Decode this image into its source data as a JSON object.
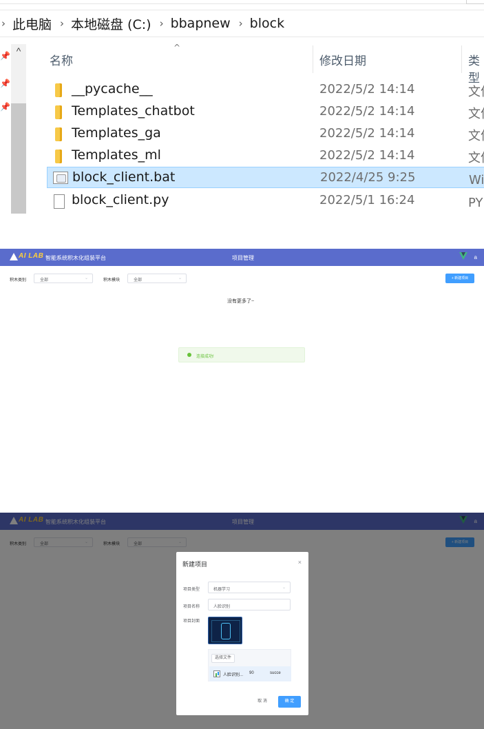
{
  "explorer": {
    "breadcrumb": [
      "此电脑",
      "本地磁盘 (C:)",
      "bbapnew",
      "block"
    ],
    "columns": {
      "name": "名称",
      "date": "修改日期",
      "type": "类型"
    },
    "rows": [
      {
        "name": "__pycache__",
        "date": "2022/5/2 14:14",
        "type": "文件夹",
        "icon": "folder-icon"
      },
      {
        "name": "Templates_chatbot",
        "date": "2022/5/2 14:14",
        "type": "文件夹",
        "icon": "folder-icon"
      },
      {
        "name": "Templates_ga",
        "date": "2022/5/2 14:14",
        "type": "文件夹",
        "icon": "folder-icon"
      },
      {
        "name": "Templates_ml",
        "date": "2022/5/2 14:14",
        "type": "文件夹",
        "icon": "folder-icon"
      },
      {
        "name": "block_client.bat",
        "date": "2022/4/25 9:25",
        "type": "Windows 批处理文件",
        "icon": "bat-file-icon",
        "selected": true
      },
      {
        "name": "block_client.py",
        "date": "2022/5/1 16:24",
        "type": "PY 文件",
        "icon": "py-file-icon"
      }
    ]
  },
  "app": {
    "logo_text": "AI LAB",
    "title": "智能系统积木化组装平台",
    "center_title": "项目管理",
    "user": "a",
    "filter_category_label": "积木类别",
    "filter_category_value": "全部",
    "filter_module_label": "积木模块",
    "filter_module_value": "全部",
    "new_button": "+ 新建项目",
    "no_more": "没有更多了~",
    "toast": "连接成功!"
  },
  "modal": {
    "title": "新建项目",
    "type_label": "项目类型",
    "type_value": "机器学习",
    "name_label": "项目名称",
    "name_value": "人脸识别",
    "cover_label": "项目封面",
    "choose_file": "选择文件",
    "file_name": "人脸识别...",
    "file_pct": "90",
    "file_status": "succe",
    "cancel": "取 消",
    "ok": "确 定"
  },
  "colors": {
    "header": "#5a6ccc",
    "primary": "#409eff",
    "success": "#67c23a",
    "selected_row": "#cce8ff"
  }
}
